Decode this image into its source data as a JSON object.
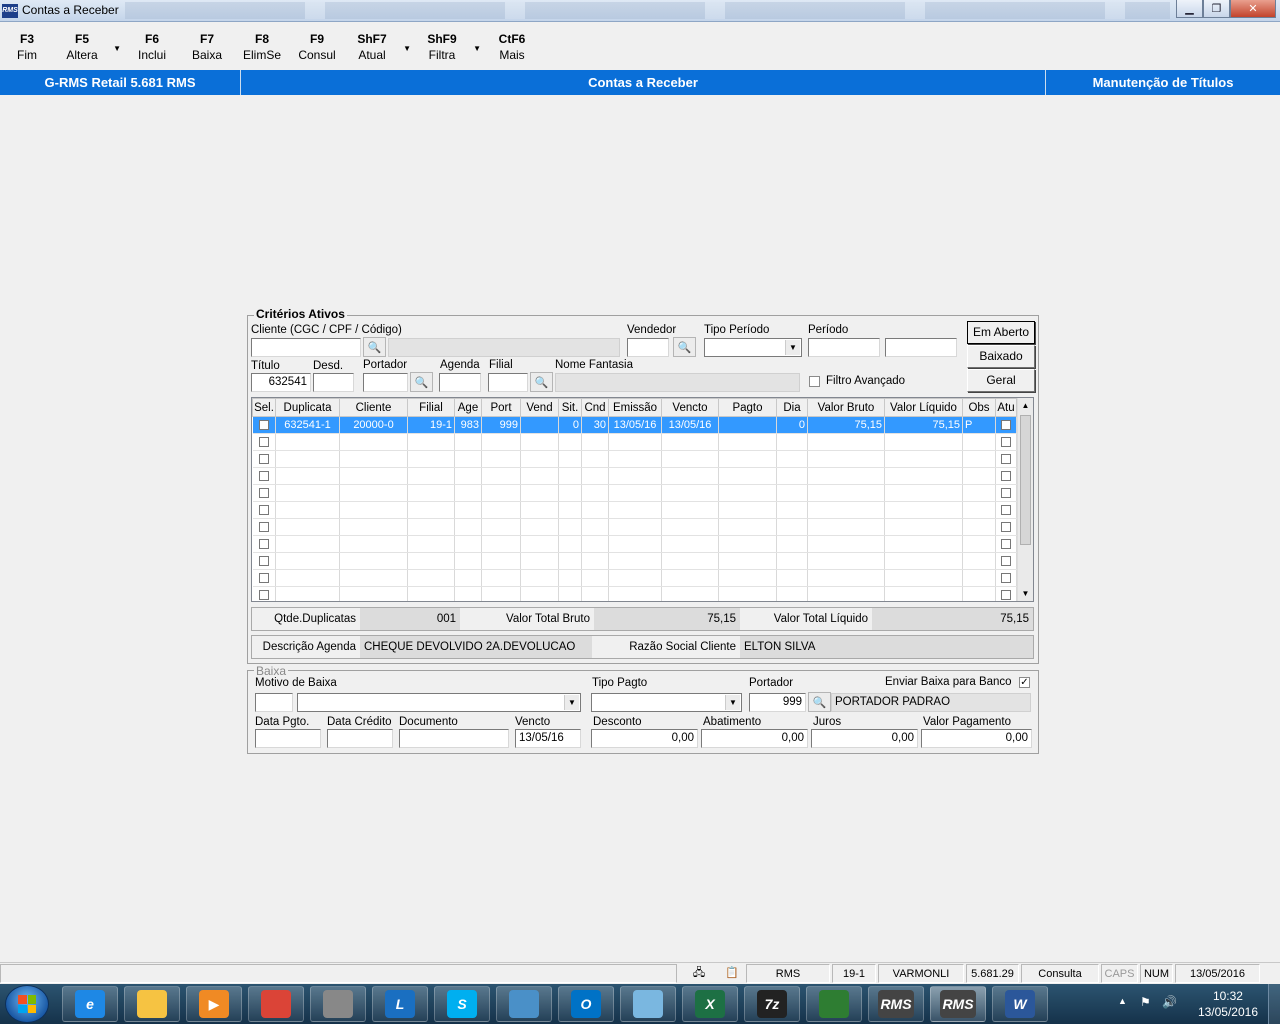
{
  "window": {
    "title": "Contas a Receber",
    "app_icon": "RMS"
  },
  "toolbar": [
    {
      "key": "F3",
      "label": "Fim",
      "dropdown": false
    },
    {
      "key": "F5",
      "label": "Altera",
      "dropdown": true
    },
    {
      "key": "F6",
      "label": "Inclui",
      "dropdown": false
    },
    {
      "key": "F7",
      "label": "Baixa",
      "dropdown": false
    },
    {
      "key": "F8",
      "label": "ElimSe",
      "dropdown": false
    },
    {
      "key": "F9",
      "label": "Consul",
      "dropdown": false
    },
    {
      "key": "ShF7",
      "label": "Atual",
      "dropdown": true
    },
    {
      "key": "ShF9",
      "label": "Filtra",
      "dropdown": true
    },
    {
      "key": "CtF6",
      "label": "Mais",
      "dropdown": false
    }
  ],
  "header": {
    "left": "G-RMS Retail 5.681 RMS",
    "center": "Contas a Receber",
    "right": "Manutenção de Títulos"
  },
  "criteria": {
    "title": "Critérios Ativos",
    "cliente_label": "Cliente (CGC / CPF / Código)",
    "cliente_value": "",
    "vendedor_label": "Vendedor",
    "tipo_periodo_label": "Tipo Período",
    "periodo_label": "Período",
    "titulo_label": "Título",
    "titulo_value": "632541",
    "desd_label": "Desd.",
    "portador_label": "Portador",
    "agenda_label": "Agenda",
    "filial_label": "Filial",
    "nome_fantasia_label": "Nome Fantasia",
    "filtro_avancado_label": "Filtro Avançado",
    "buttons": {
      "em_aberto": "Em Aberto",
      "baixado": "Baixado",
      "geral": "Geral"
    }
  },
  "grid": {
    "columns": [
      "Sel.",
      "Duplicata",
      "Cliente",
      "Filial",
      "Age",
      "Port",
      "Vend",
      "Sit.",
      "Cnd",
      "Emissão",
      "Vencto",
      "Pagto",
      "Dia",
      "Valor Bruto",
      "Valor Líquido",
      "Obs",
      "Atu"
    ],
    "rows": [
      {
        "duplicata": "632541-1",
        "cliente": "20000-0",
        "filial": "19-1",
        "age": "983",
        "port": "999",
        "vend": "",
        "sit": "0",
        "cnd": "30",
        "emissao": "13/05/16",
        "vencto": "13/05/16",
        "pagto": "",
        "dia": "0",
        "valor_bruto": "75,15",
        "valor_liquido": "75,15",
        "obs": "P"
      }
    ],
    "empty_rows": 10
  },
  "summary": {
    "qtde_label": "Qtde.Duplicatas",
    "qtde_value": "001",
    "bruto_label": "Valor Total Bruto",
    "bruto_value": "75,15",
    "liquido_label": "Valor Total Líquido",
    "liquido_value": "75,15",
    "desc_agenda_label": "Descrição Agenda",
    "desc_agenda_value": "CHEQUE DEVOLVIDO 2A.DEVOLUCAO",
    "razao_label": "Razão Social Cliente",
    "razao_value": "ELTON SILVA"
  },
  "baixa": {
    "title": "Baixa",
    "motivo_label": "Motivo de Baixa",
    "tipo_pagto_label": "Tipo Pagto",
    "portador_label": "Portador",
    "portador_value": "999",
    "portador_nome": "PORTADOR PADRAO",
    "enviar_label": "Enviar Baixa para Banco",
    "enviar_checked": "✓",
    "data_pgto_label": "Data Pgto.",
    "data_credito_label": "Data Crédito",
    "documento_label": "Documento",
    "vencto_label": "Vencto",
    "vencto_value": "13/05/16",
    "desconto_label": "Desconto",
    "desconto_value": "0,00",
    "abatimento_label": "Abatimento",
    "abatimento_value": "0,00",
    "juros_label": "Juros",
    "juros_value": "0,00",
    "valor_pagamento_label": "Valor Pagamento",
    "valor_pagamento_value": "0,00"
  },
  "statusbar": [
    "RMS",
    "19-1",
    "VARMONLI",
    "5.681.29",
    "Consulta",
    "CAPS",
    "NUM",
    "13/05/2016"
  ],
  "taskbar": {
    "apps": [
      "ie-icon",
      "explorer-icon",
      "media-player-icon",
      "chrome-icon",
      "apps-grid-icon",
      "lync-icon",
      "skype-icon",
      "remote-desktop-icon",
      "outlook-icon",
      "notes-icon",
      "excel-icon",
      "7zip-icon",
      "network-icon",
      "rms-icon",
      "rms-icon",
      "word-icon"
    ],
    "app_labels": [
      "e",
      "",
      "▶",
      "",
      "",
      "L",
      "S",
      "",
      "O",
      "",
      "X",
      "7z",
      "",
      "RMS",
      "RMS",
      "W"
    ],
    "clock_time": "10:32",
    "clock_date": "13/05/2016"
  }
}
